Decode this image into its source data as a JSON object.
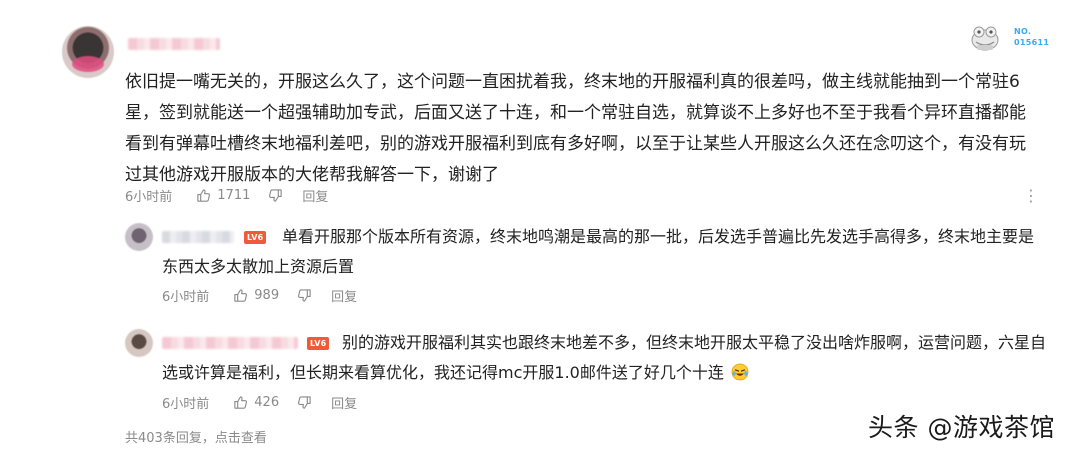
{
  "comment": {
    "lines": [
      "依旧提一嘴无关的，开服这么久了，这个问题一直困扰着我，终末地的开服福利真的很差吗，做主线就能抽到一个常驻6",
      "星，签到就能送一个超强辅助加专武，后面又送了十连，和一个常驻自选，就算谈不上多好也不至于我看个异环直播都能",
      "看到有弹幕吐槽终末地福利差吧，别的游戏开服福利到底有多好啊，以至于让某些人开服这么久还在念叨这个，有没有玩",
      "过其他游戏开服版本的大佬帮我解答一下，谢谢了"
    ],
    "time": "6小时前",
    "likes": "1711",
    "reply_label": "回复",
    "more_icon": "more-vertical-icon",
    "stamp_label_1": "NO.",
    "stamp_label_2": "015611"
  },
  "replies": [
    {
      "badge": "LV6",
      "lines": [
        "单看开服那个版本所有资源，终末地鸣潮是最高的那一批，后发选手普遍比先发选手高得多，终末地主要是",
        "东西太多太散加上资源后置"
      ],
      "time": "6小时前",
      "likes": "989",
      "reply_label": "回复"
    },
    {
      "badge": "LV6",
      "lines": [
        "别的游戏开服福利其实也跟终末地差不多，但终末地开服太平稳了没出啥炸服啊，运营问题，六星自",
        "选或许算是福利，但长期来看算优化，我还记得mc开服1.0邮件送了好几个十连"
      ],
      "time": "6小时前",
      "likes": "426",
      "reply_label": "回复"
    }
  ],
  "footer": {
    "more_replies": "共403条回复，点击查看"
  },
  "watermark": "头条 @游戏茶馆",
  "colors": {
    "badge": "#ef5a3a",
    "meta": "#8a8a8a",
    "stamp_text": "#3da9ee"
  }
}
